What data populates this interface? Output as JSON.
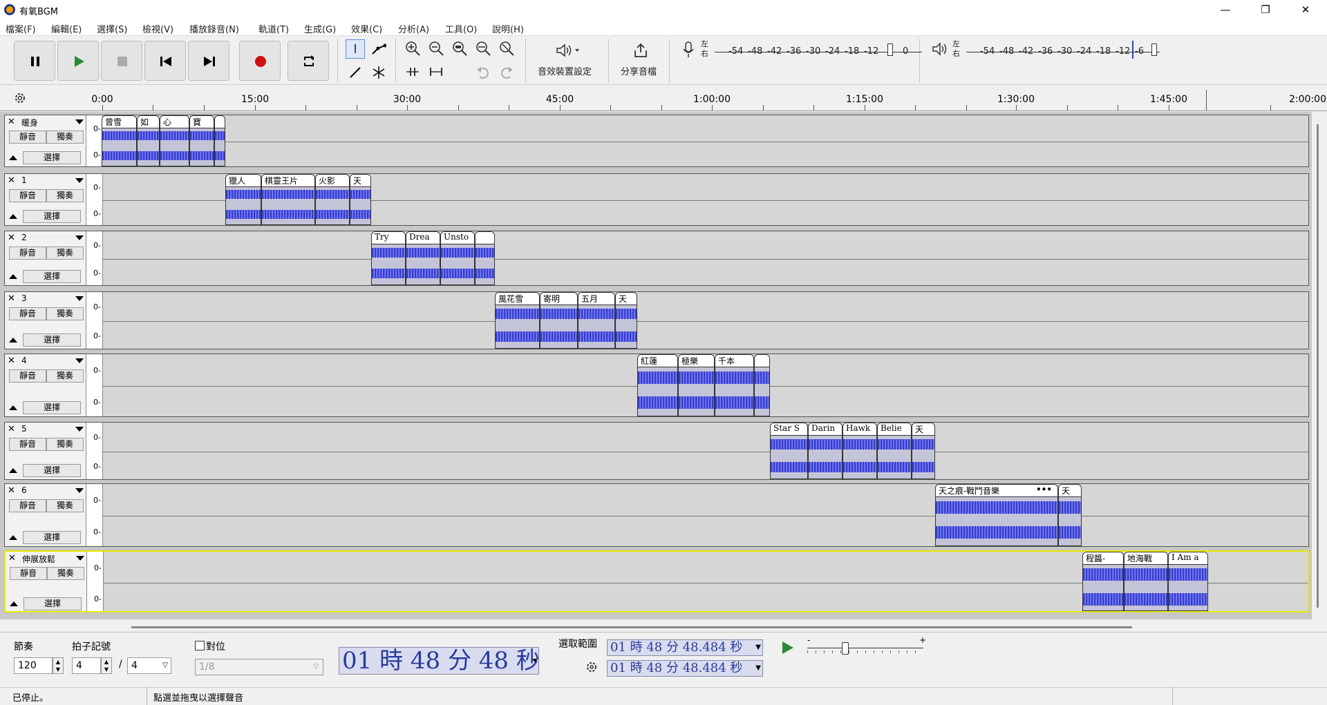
{
  "window": {
    "title": "有氧BGM",
    "minimize": "—",
    "restore": "❐",
    "close": "✕"
  },
  "menu": [
    "檔案(F)",
    "編輯(E)",
    "選擇(S)",
    "檢視(V)",
    "播放錄音(N)",
    "軌道(T)",
    "生成(G)",
    "效果(C)",
    "分析(A)",
    "工具(O)",
    "說明(H)"
  ],
  "toolbar": {
    "transport": [
      "pause",
      "play",
      "stop",
      "skip-start",
      "skip-end",
      "record",
      "loop"
    ],
    "audio_setup": "音效裝置設定",
    "share": "分享音檔",
    "meter_rec": {
      "lr": [
        "左",
        "右"
      ],
      "scale": [
        "-54",
        "-48",
        "-42",
        "-36",
        "-30",
        "-24",
        "-18",
        "-12",
        "",
        "0"
      ]
    },
    "meter_play": {
      "lr": [
        "左",
        "右"
      ],
      "scale": [
        "-54",
        "-48",
        "-42",
        "-36",
        "-30",
        "-24",
        "-18",
        "-12",
        "-6",
        ""
      ]
    }
  },
  "ruler": {
    "ticks": [
      "0:00",
      "15:00",
      "30:00",
      "45:00",
      "1:00:00",
      "1:15:00",
      "1:30:00",
      "1:45:00",
      "2:00:00"
    ]
  },
  "track_buttons": {
    "mute": "靜音",
    "solo": "獨奏",
    "select": "選擇"
  },
  "tracks": [
    {
      "name": "暖身",
      "clips": [
        {
          "label": "曾雪"
        },
        {
          "label": "如"
        },
        {
          "label": "心"
        },
        {
          "label": "寶"
        },
        {
          "label": ""
        }
      ]
    },
    {
      "name": "1",
      "clips": [
        {
          "label": "獵人"
        },
        {
          "label": "棋靈王片"
        },
        {
          "label": "火影"
        },
        {
          "label": "天"
        }
      ]
    },
    {
      "name": "2",
      "clips": [
        {
          "label": "Try"
        },
        {
          "label": "Drea"
        },
        {
          "label": "Unsto"
        },
        {
          "label": ""
        }
      ]
    },
    {
      "name": "3",
      "clips": [
        {
          "label": "風花雪"
        },
        {
          "label": "寄明"
        },
        {
          "label": "五月"
        },
        {
          "label": "天"
        }
      ]
    },
    {
      "name": "4",
      "clips": [
        {
          "label": "紅蓮"
        },
        {
          "label": "極樂"
        },
        {
          "label": "千本"
        },
        {
          "label": ""
        }
      ]
    },
    {
      "name": "5",
      "clips": [
        {
          "label": "Star S"
        },
        {
          "label": "Darin"
        },
        {
          "label": "Hawk"
        },
        {
          "label": "Belie"
        },
        {
          "label": "天"
        }
      ]
    },
    {
      "name": "6",
      "clips": [
        {
          "label": "天之痕-戰鬥音樂"
        },
        {
          "label": "天"
        }
      ]
    },
    {
      "name": "伸展放鬆",
      "clips": [
        {
          "label": "程醬-"
        },
        {
          "label": "地海戰"
        },
        {
          "label": "I Am a"
        }
      ]
    }
  ],
  "bottom": {
    "tempo_label": "節奏",
    "tempo": "120",
    "timesig_label": "拍子記號",
    "timesig_num": "4",
    "timesig_sep": "/",
    "timesig_den": "4",
    "snap_label": "對位",
    "snap_value": "1/8",
    "time_display": "01 時 48 分 48 秒",
    "selection_label": "選取範圍",
    "sel_start": "01 時 48 分 48.484 秒",
    "sel_end": "01 時 48 分 48.484 秒",
    "speed_minus": "-",
    "speed_plus": "+"
  },
  "status": {
    "left": "已停止。",
    "right": "點選並拖曳以選擇聲音"
  }
}
